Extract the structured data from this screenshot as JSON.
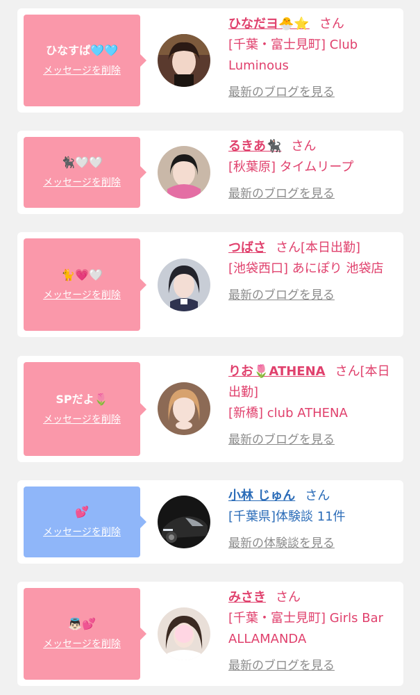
{
  "delete_label": "メッセージを削除",
  "honorific": "さん",
  "colors": {
    "pink_bubble": "#fa98aa",
    "blue_bubble": "#8fb6f9",
    "pink_text": "#e0416d",
    "blue_text": "#2b6cb8",
    "link_gray": "#8c8c8c"
  },
  "cards": [
    {
      "message": "ひなすぱ🩵🩵",
      "name": "ひなだヨ🐣⭐",
      "suffix": "",
      "shop": "[千葉・富士見町] Club Luminous",
      "link": "最新のブログを見る"
    },
    {
      "message": "🐈‍⬛🤍🤍",
      "name": "るきあ🐈‍⬛",
      "suffix": "",
      "shop": "[秋葉原] タイムリープ",
      "link": "最新のブログを見る"
    },
    {
      "message": "🐈💗🤍",
      "name": "つばさ",
      "suffix": "[本日出勤]",
      "shop": "[池袋西口] あにぽり 池袋店",
      "link": "最新のブログを見る"
    },
    {
      "message": "SPだよ🌷",
      "name": "りお🌷ATHENA",
      "suffix": "[本日出勤]",
      "shop": "[新橋] club ATHENA",
      "link": "最新のブログを見る"
    },
    {
      "message": "💕",
      "name": "小林 じゅん",
      "suffix": "",
      "shop": "[千葉県]体験談 11件",
      "link": "最新の体験談を見る"
    },
    {
      "message": "👼🏻💕",
      "name": "みさき",
      "suffix": "",
      "shop": "[千葉・富士見町] Girls Bar ALLAMANDA",
      "link": "最新のブログを見る"
    }
  ]
}
